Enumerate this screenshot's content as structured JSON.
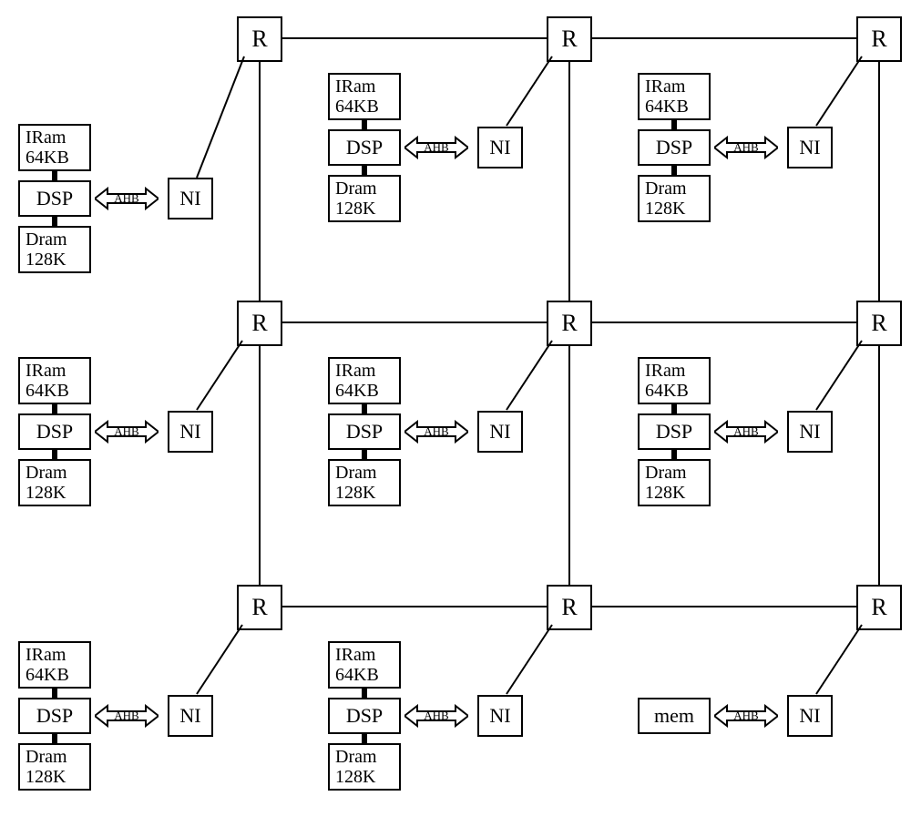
{
  "symbols": {
    "router": "R",
    "ni": "NI",
    "dsp": "DSP",
    "mem": "mem",
    "ahb": "AHB",
    "iram_l1": "IRam",
    "iram_l2": "64KB",
    "dram_l1": "Dram",
    "dram_l2": "128K"
  },
  "chart_data": {
    "type": "diagram",
    "title": "",
    "topology": "3x3 mesh Network-on-Chip",
    "routers": 9,
    "grid": {
      "rows": 3,
      "cols": 3
    },
    "tiles": [
      {
        "row": 0,
        "col": 0,
        "type": "dsp",
        "iram_kb": 64,
        "dram_kb": 128,
        "bus": "AHB"
      },
      {
        "row": 0,
        "col": 1,
        "type": "dsp",
        "iram_kb": 64,
        "dram_kb": 128,
        "bus": "AHB"
      },
      {
        "row": 0,
        "col": 2,
        "type": "dsp",
        "iram_kb": 64,
        "dram_kb": 128,
        "bus": "AHB"
      },
      {
        "row": 1,
        "col": 0,
        "type": "dsp",
        "iram_kb": 64,
        "dram_kb": 128,
        "bus": "AHB"
      },
      {
        "row": 1,
        "col": 1,
        "type": "dsp",
        "iram_kb": 64,
        "dram_kb": 128,
        "bus": "AHB"
      },
      {
        "row": 1,
        "col": 2,
        "type": "dsp",
        "iram_kb": 64,
        "dram_kb": 128,
        "bus": "AHB"
      },
      {
        "row": 2,
        "col": 0,
        "type": "dsp",
        "iram_kb": 64,
        "dram_kb": 128,
        "bus": "AHB"
      },
      {
        "row": 2,
        "col": 1,
        "type": "dsp",
        "iram_kb": 64,
        "dram_kb": 128,
        "bus": "AHB"
      },
      {
        "row": 2,
        "col": 2,
        "type": "mem",
        "bus": "AHB"
      }
    ],
    "links": {
      "mesh_horizontal": true,
      "mesh_vertical": true,
      "router_to_ni_diagonal": true
    }
  }
}
